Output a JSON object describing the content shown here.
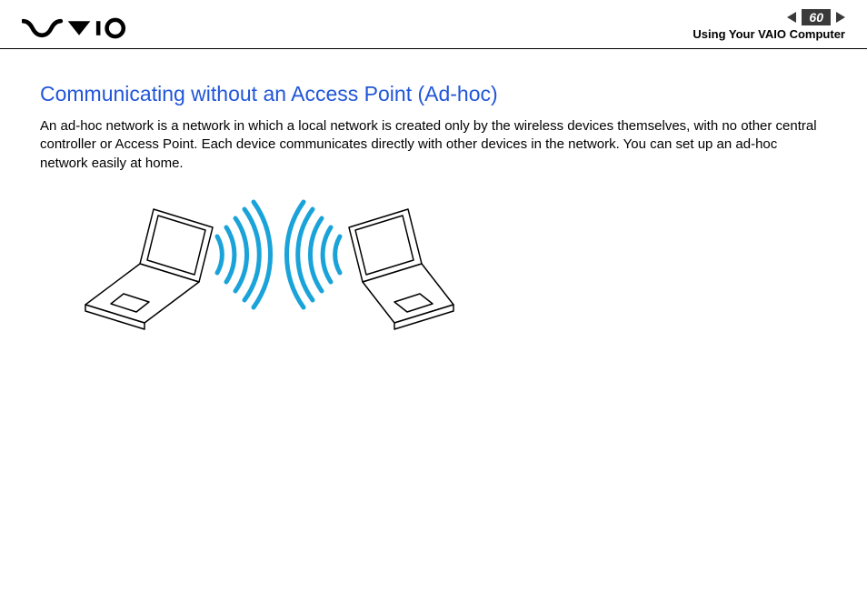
{
  "header": {
    "page_number": "60",
    "subtitle": "Using Your VAIO Computer"
  },
  "content": {
    "heading": "Communicating without an Access Point (Ad-hoc)",
    "body": "An ad-hoc network is a network in which a local network is created only by the wireless devices themselves, with no other central controller or Access Point. Each device communicates directly with other devices in the network. You can set up an ad-hoc network easily at home."
  }
}
